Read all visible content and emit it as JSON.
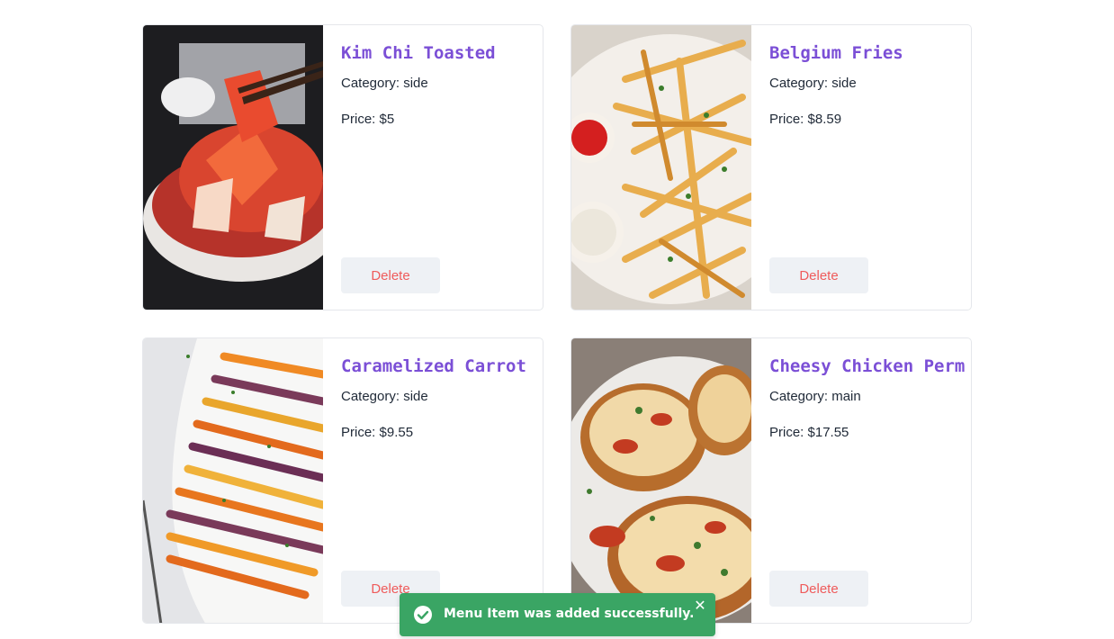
{
  "menu_items": [
    {
      "name": "Kim Chi Toasted",
      "category": "Category: side",
      "price": "Price: $5",
      "delete_label": "Delete",
      "image": "kimchi-photo"
    },
    {
      "name": "Belgium Fries",
      "category": "Category: side",
      "price": "Price: $8.59",
      "delete_label": "Delete",
      "image": "fries-photo"
    },
    {
      "name": "Caramelized Carrot",
      "category": "Category: side",
      "price": "Price: $9.55",
      "delete_label": "Delete",
      "image": "carrot-photo"
    },
    {
      "name": "Cheesy Chicken Perm",
      "category": "Category: main",
      "price": "Price: $17.55",
      "delete_label": "Delete",
      "image": "chicken-parm-photo"
    }
  ],
  "toast": {
    "message": "Menu Item was added successfully.",
    "icon": "check-circle-icon",
    "close_icon": "close-icon",
    "color": "#3aa564"
  },
  "colors": {
    "title": "#7b4fd6",
    "delete_text": "#ef5b5b",
    "delete_bg": "#eef1f5"
  }
}
